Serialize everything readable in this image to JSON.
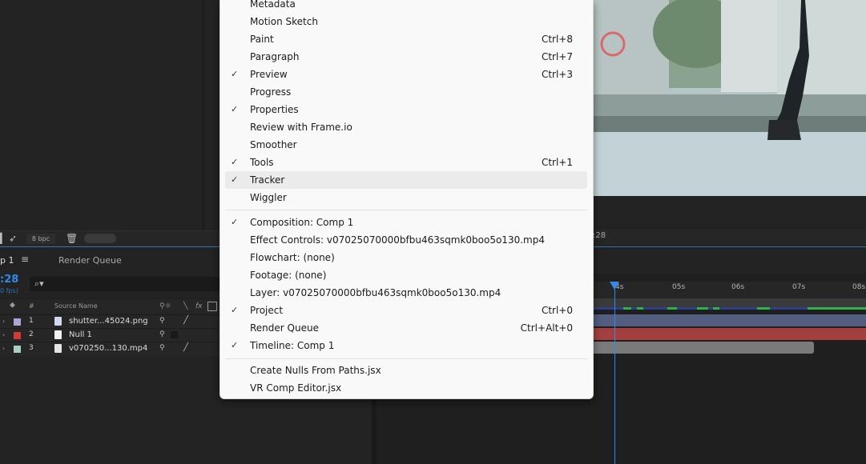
{
  "project_panel": {
    "bpc_label": "8 bpc"
  },
  "viewer": {
    "timecode": ":28"
  },
  "timeline": {
    "tab_comp": "p 1",
    "tab_render_queue": "Render Queue",
    "timecode": ":28",
    "timecode_sub": "0 fps)",
    "columns": {
      "hash": "#",
      "source_name": "Source Name",
      "fx": "fx"
    },
    "layers": [
      {
        "num": "1",
        "name": "shutter...45024.png",
        "color": "#a9a7d6",
        "icon_color": "#cfd8ee"
      },
      {
        "num": "2",
        "name": "Null 1",
        "color": "#d23a3a",
        "icon_color": "#f2f2f2"
      },
      {
        "num": "3",
        "name": "v070250...130.mp4",
        "color": "#a8cfc3",
        "icon_color": "#e5e5e5"
      }
    ],
    "ruler_ticks": [
      "4s",
      "05s",
      "06s",
      "07s",
      "08s"
    ],
    "colors": {
      "accent": "#2d8ceb",
      "layer_bar_png": "#525d80",
      "layer_bar_null": "#a33f3f",
      "layer_bar_video": "#7a7a7a",
      "keyframe": "#2bb34a"
    }
  },
  "window_menu": {
    "items": [
      {
        "label": "Metadata",
        "checked": false,
        "shortcut": ""
      },
      {
        "label": "Motion Sketch",
        "checked": false,
        "shortcut": ""
      },
      {
        "label": "Paint",
        "checked": false,
        "shortcut": "Ctrl+8"
      },
      {
        "label": "Paragraph",
        "checked": false,
        "shortcut": "Ctrl+7"
      },
      {
        "label": "Preview",
        "checked": true,
        "shortcut": "Ctrl+3"
      },
      {
        "label": "Progress",
        "checked": false,
        "shortcut": ""
      },
      {
        "label": "Properties",
        "checked": true,
        "shortcut": ""
      },
      {
        "label": "Review with Frame.io",
        "checked": false,
        "shortcut": ""
      },
      {
        "label": "Smoother",
        "checked": false,
        "shortcut": ""
      },
      {
        "label": "Tools",
        "checked": true,
        "shortcut": "Ctrl+1"
      },
      {
        "label": "Tracker",
        "checked": true,
        "shortcut": "",
        "highlighted": true
      },
      {
        "label": "Wiggler",
        "checked": false,
        "shortcut": ""
      },
      {
        "label": "Composition: Comp 1",
        "checked": true,
        "shortcut": ""
      },
      {
        "label": "Effect Controls: v07025070000bfbu463sqmk0boo5o130.mp4",
        "checked": false,
        "shortcut": ""
      },
      {
        "label": "Flowchart: (none)",
        "checked": false,
        "shortcut": ""
      },
      {
        "label": "Footage: (none)",
        "checked": false,
        "shortcut": ""
      },
      {
        "label": "Layer: v07025070000bfbu463sqmk0boo5o130.mp4",
        "checked": false,
        "shortcut": ""
      },
      {
        "label": "Project",
        "checked": true,
        "shortcut": "Ctrl+0"
      },
      {
        "label": "Render Queue",
        "checked": false,
        "shortcut": "Ctrl+Alt+0"
      },
      {
        "label": "Timeline: Comp 1",
        "checked": true,
        "shortcut": ""
      },
      {
        "label": "Create Nulls From Paths.jsx",
        "checked": false,
        "shortcut": ""
      },
      {
        "label": "VR Comp Editor.jsx",
        "checked": false,
        "shortcut": ""
      }
    ],
    "check_glyph": "✓"
  }
}
